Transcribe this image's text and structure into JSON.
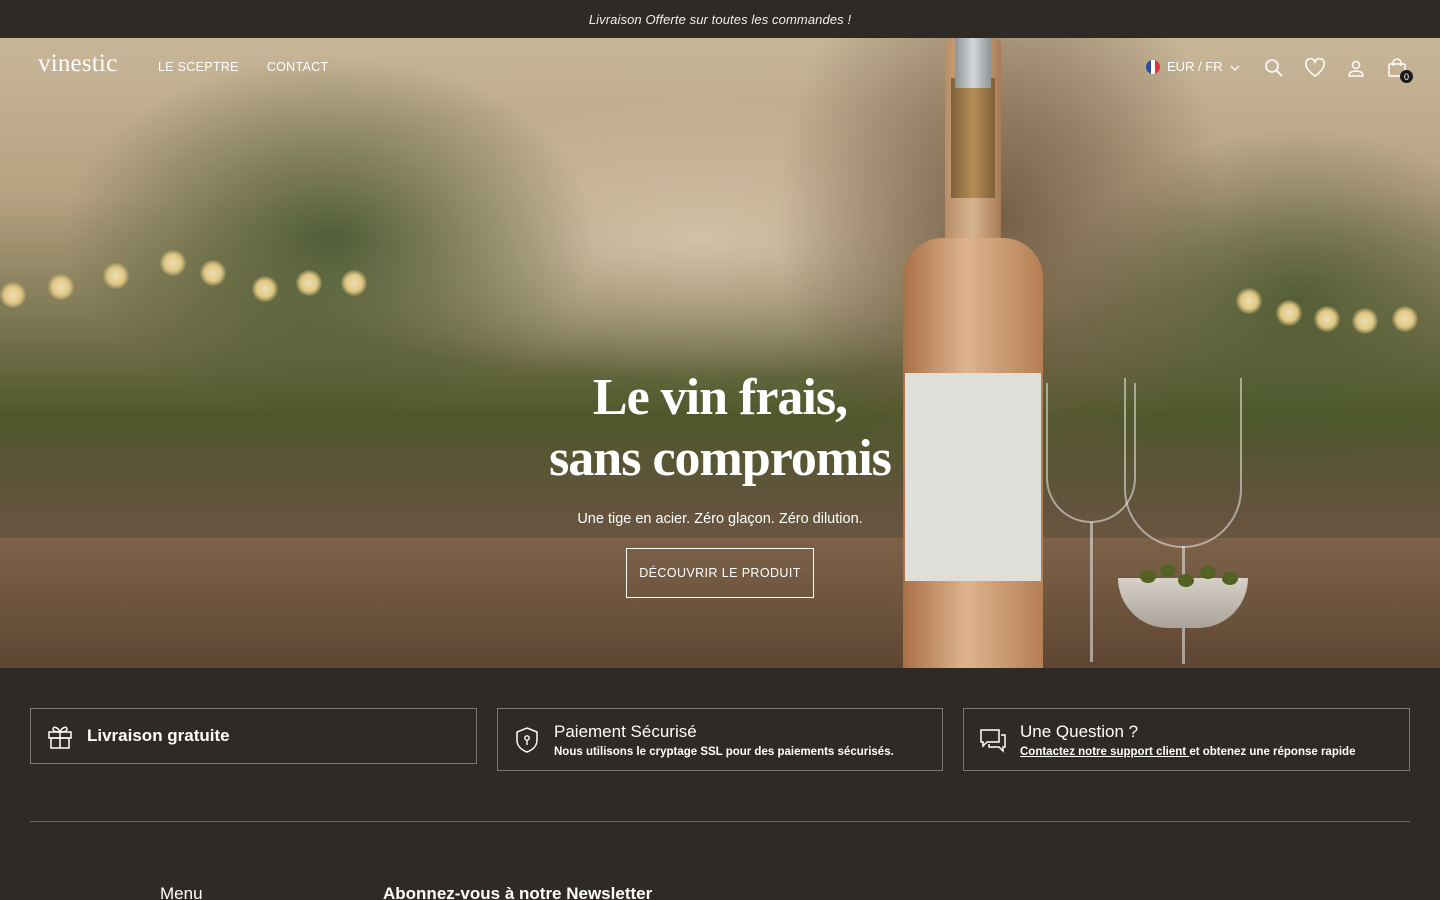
{
  "announcement": {
    "text": "Livraison Offerte sur toutes les commandes !"
  },
  "header": {
    "logo": "vinestic",
    "nav": [
      {
        "label": "LE SCEPTRE"
      },
      {
        "label": "CONTACT"
      }
    ],
    "locale": "EUR / FR",
    "cart_count": "0",
    "icons": [
      "search-icon",
      "heart-icon",
      "user-icon",
      "shopping-bag-icon"
    ]
  },
  "hero": {
    "title_line1": "Le vin frais,",
    "title_line2": "sans compromis",
    "subtitle": "Une tige en acier. Zéro glaçon. Zéro dilution.",
    "cta_label": "DÉCOUVRIR LE PRODUIT"
  },
  "features": [
    {
      "title": "Livraison gratuite",
      "icon": "gift-icon"
    },
    {
      "title": "Paiement Sécurisé",
      "desc": "Nous utilisons le cryptage SSL pour des paiements sécurisés.",
      "icon": "shield-icon"
    },
    {
      "title": "Une Question ?",
      "link_text": "Contactez notre support client ",
      "desc_rest": "et obtenez une réponse rapide",
      "icon": "chat-icon"
    }
  ],
  "footer": {
    "menu_heading": "Menu",
    "newsletter_heading": "Abonnez-vous à notre Newsletter"
  },
  "colors": {
    "background": "#2e2a25",
    "border": "#7d776f",
    "text": "#ffffff"
  }
}
